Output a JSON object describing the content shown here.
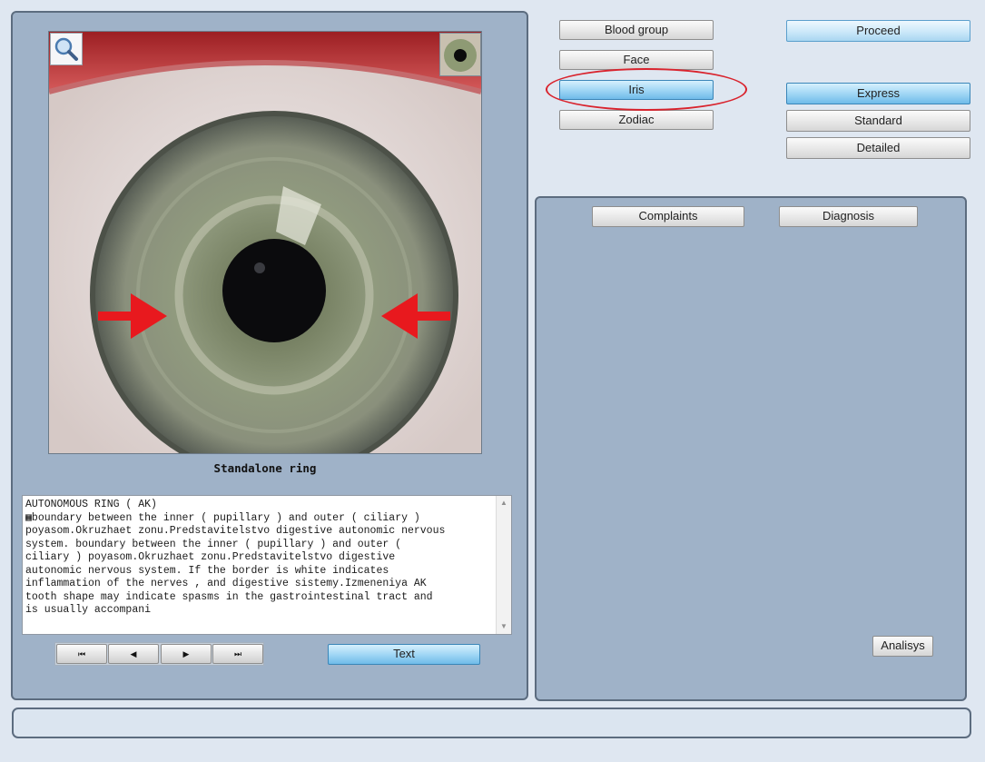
{
  "category_buttons": [
    {
      "label": "Blood group",
      "active": false
    },
    {
      "label": "Face",
      "active": false
    },
    {
      "label": "Iris",
      "active": true
    },
    {
      "label": "Zodiac",
      "active": false
    }
  ],
  "proceed_label": "Proceed",
  "mode_buttons": [
    {
      "label": "Express",
      "active": true
    },
    {
      "label": "Standard",
      "active": false
    },
    {
      "label": "Detailed",
      "active": false
    }
  ],
  "tabs": {
    "complaints_label": "Complaints",
    "diagnosis_label": "Diagnosis"
  },
  "analysis_label": "Analisys",
  "image": {
    "caption": "Standalone ring",
    "zoom_icon": "magnifier-icon",
    "thumbnail": "eye-thumbnail"
  },
  "description": {
    "text": "AUTONOMOUS RING ( AK)\n▦boundary between the inner ( pupillary ) and outer ( ciliary )\npoyasom.Okruzhaet zonu.Predstavitelstvo digestive autonomic nervous\nsystem. boundary between the inner ( pupillary ) and outer (\nciliary ) poyasom.Okruzhaet zonu.Predstavitelstvo digestive\nautonomic nervous system. If the border is white indicates\ninflammation of the nerves , and digestive sistemy.Izmeneniya AK\ntooth shape may indicate spasms in the gastrointestinal tract and\nis usually accompani"
  },
  "navigation": {
    "first": "⏮",
    "prev": "◀",
    "next": "▶",
    "last": "⏭"
  },
  "text_button_label": "Text",
  "colors": {
    "accent_button": "#a2d7f5",
    "panel": "#9fb2c8",
    "highlight_ellipse": "#d9232d",
    "arrows": "#e8191e"
  }
}
